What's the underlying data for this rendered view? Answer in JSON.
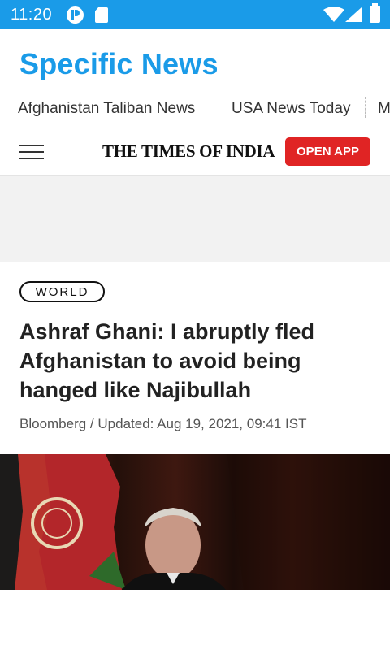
{
  "status_bar": {
    "time": "11:20",
    "icons": [
      "pocket-app-icon",
      "sd-card-icon",
      "wifi-icon",
      "cell-signal-icon",
      "battery-icon"
    ]
  },
  "header": {
    "title": "Specific News",
    "color": "#1a9be8"
  },
  "topics": [
    {
      "label": "Afghanistan Taliban News"
    },
    {
      "label": "USA News Today"
    },
    {
      "label": "M"
    }
  ],
  "publisher_bar": {
    "logo_text": "THE TIMES OF INDIA",
    "open_app_label": "OPEN APP",
    "button_color": "#e02424",
    "menu_icon": "hamburger-menu-icon"
  },
  "article": {
    "category": "WORLD",
    "headline": "Ashraf Ghani: I abruptly fled Afghanistan to avoid being hanged like Najibullah",
    "byline": "Bloomberg / Updated: Aug 19, 2021, 09:41 IST"
  }
}
